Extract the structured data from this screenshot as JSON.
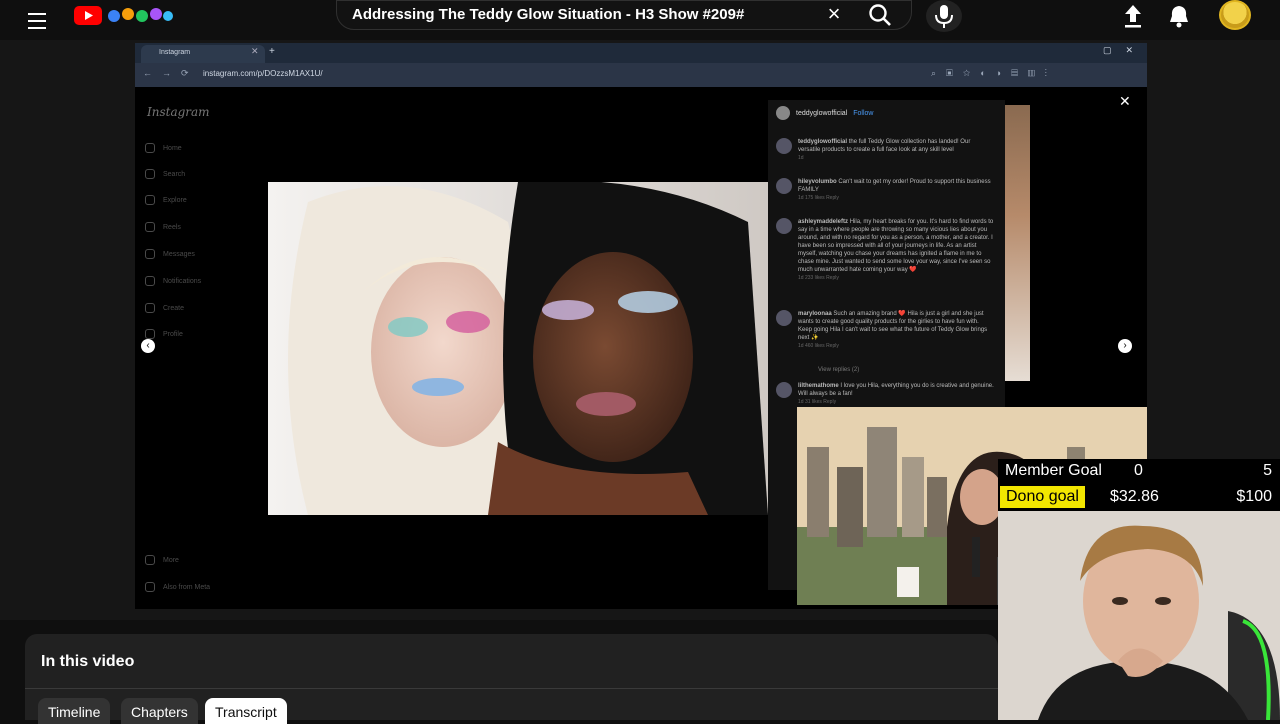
{
  "header": {
    "search_query": "Addressing The Teddy Glow Situation - H3 Show #209#",
    "clear_symbol": "×"
  },
  "browser": {
    "tab_title": "Instagram",
    "url": "instagram.com/p/DOzzsM1AX1U/",
    "ig_logo": "Instagram",
    "ig_nav": [
      "Home",
      "Search",
      "Explore",
      "Reels",
      "Messages",
      "Notifications",
      "Create",
      "Profile"
    ],
    "ig_bottom_nav": [
      "More",
      "Also from Meta"
    ],
    "post_author": "teddyglowofficial",
    "follow_label": "Follow",
    "comments": [
      {
        "user": "teddyglowofficial",
        "text": "the full Teddy Glow collection has landed! Our versatile products to create a full face look at any skill level",
        "meta": "1d"
      },
      {
        "user": "hileyvolumbo",
        "text": "Can't wait to get my order! Proud to support this business FAMILY",
        "meta": "1d  175 likes  Reply"
      },
      {
        "user": "ashleymaddeleftz",
        "text": "Hila, my heart breaks for you. It's hard to find words to say in a time where people are throwing so many vicious lies about you around, and with no regard for you as a person, a mother, and a creator. I have been so impressed with all of your journeys in life. As an artist myself, watching you chase your dreams has ignited a flame in me to chase mine. Just wanted to send some love your way, since I've seen so much unwarranted hate coming your way ❤️",
        "meta": "1d  233 likes  Reply"
      },
      {
        "user": "maryloonaa",
        "text": "Such an amazing brand ❤️ Hila is just a girl and she just wants to create good quality products for the girlies to have fun with. Keep going Hila I can't wait to see what the future of Teddy Glow brings next ✨",
        "meta": "1d  460 likes  Reply"
      },
      {
        "user": "",
        "text": "View replies (2)",
        "meta": ""
      },
      {
        "user": "lilthemathome",
        "text": "I love you Hila, everything you do is creative and genuine. Will always be a fan!",
        "meta": "1d  31 likes  Reply"
      }
    ]
  },
  "overlay": {
    "member_goal_label": "Member Goal",
    "member_current": "0",
    "member_max": "5",
    "dono_goal_label": "Dono goal",
    "dono_current": "$32.86",
    "dono_max": "$100",
    "highlight_color": "#f2e600"
  },
  "panel": {
    "title": "In this video",
    "tabs": [
      {
        "label": "Timeline",
        "active": false
      },
      {
        "label": "Chapters",
        "active": false
      },
      {
        "label": "Transcript",
        "active": true
      }
    ]
  }
}
